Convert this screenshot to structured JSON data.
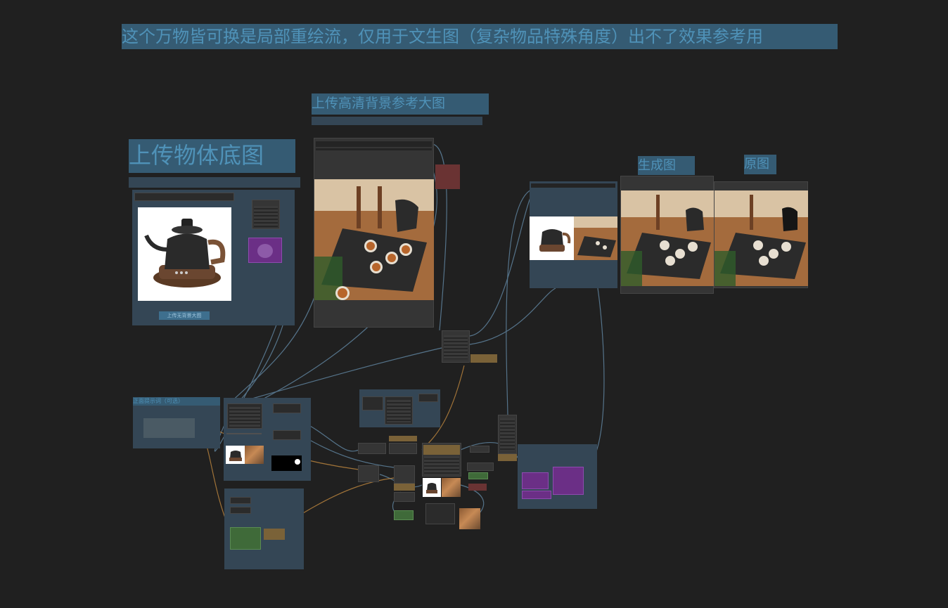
{
  "top_note": "这个万物皆可换是局部重绘流，仅用于文生图（复杂物品特殊角度）出不了效果参考用",
  "upload_object": {
    "title": "上传物体底图",
    "button_label": "上传无背景大图"
  },
  "upload_background": {
    "title": "上传高清背景参考大图"
  },
  "result_label": "生成图",
  "original_label": "原图",
  "prompt_group": {
    "title": "正面提示词（可选）"
  },
  "colors": {
    "canvas": "#202020",
    "group": "#344655",
    "banner": "#355b73",
    "wire_blue": "#5b7d96",
    "wire_orange": "#c0883f"
  },
  "icons": [
    "kettle-image",
    "tea-scene-image",
    "mask-preview"
  ]
}
